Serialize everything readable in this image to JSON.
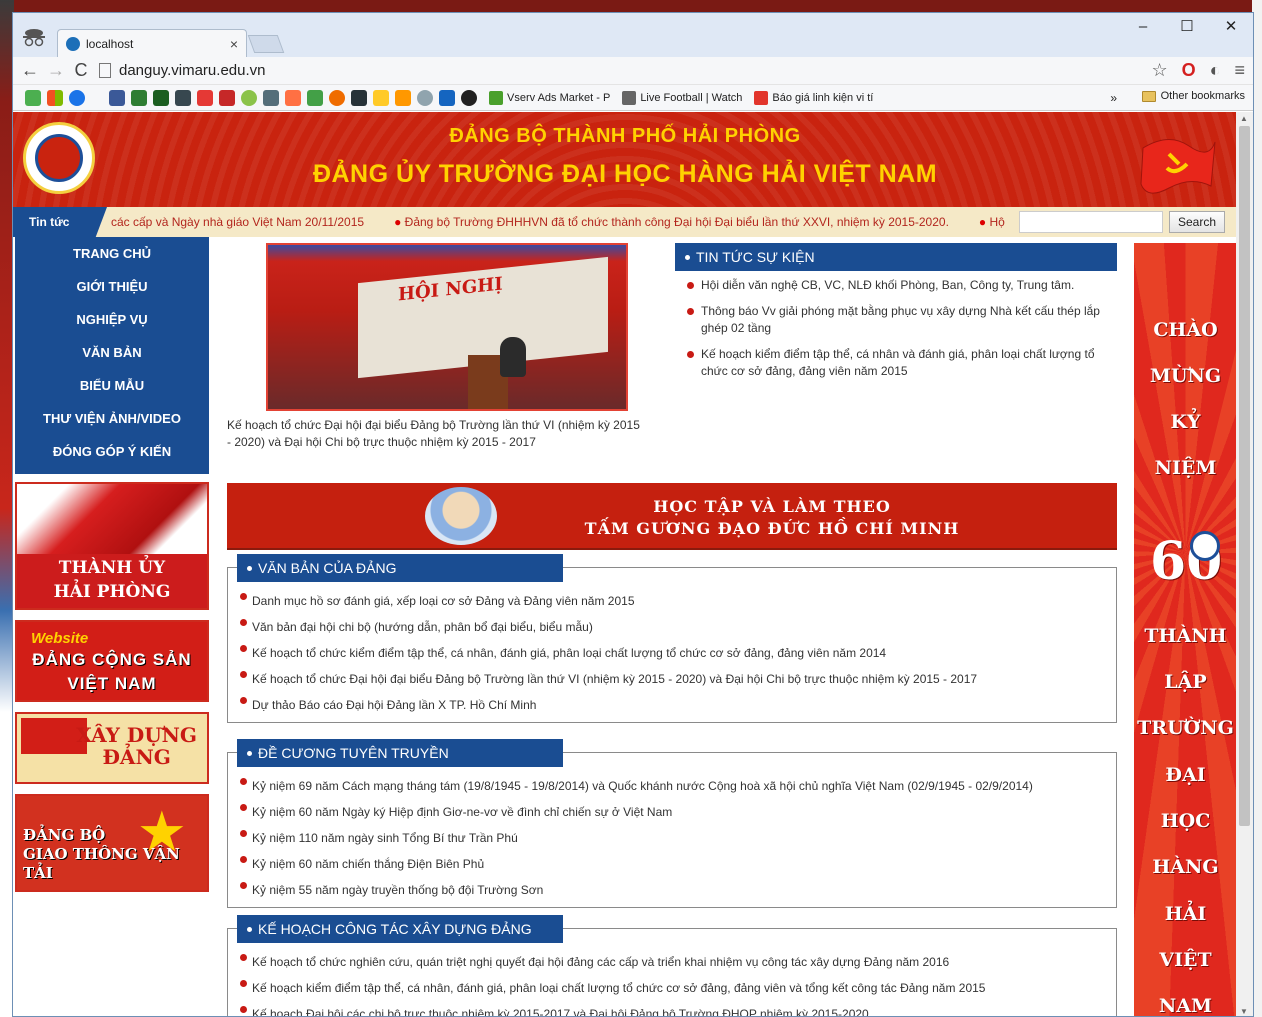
{
  "browser": {
    "tab_title": "localhost",
    "tab_close": "×",
    "window_controls": [
      "–",
      "☐",
      "✕"
    ],
    "url": "danguy.vimaru.edu.vn",
    "bookmarks": [
      {
        "label": "Vserv Ads Market - P",
        "icon_color": "#4aa02c"
      },
      {
        "label": "Live Football | Watch",
        "icon_color": "#666666"
      },
      {
        "label": "Báo giá linh kiện vi tí",
        "icon_color": "#e2352c"
      }
    ],
    "bookmarks_more": "»",
    "other_bookmarks": "Other bookmarks"
  },
  "header": {
    "line1": "ĐẢNG BỘ THÀNH PHỐ HẢI PHÒNG",
    "line2": "ĐẢNG ỦY TRƯỜNG ĐẠI HỌC HÀNG HẢI VIỆT NAM"
  },
  "ticker": {
    "label": "Tin tức",
    "items": [
      "các cấp và Ngày nhà giáo Việt Nam 20/11/2015",
      "Đảng bộ Trường ĐHHHVN đã tổ chức thành công Đại hội Đại biểu lần thứ XXVI, nhiệm kỳ 2015-2020.",
      "Hộ"
    ],
    "search_button": "Search"
  },
  "menu": [
    "TRANG CHỦ",
    "GIỚI THIỆU",
    "NGHIỆP VỤ",
    "VĂN BẢN",
    "BIỂU MẪU",
    "THƯ VIỆN ẢNH/VIDEO",
    "ĐÓNG GÓP Ý KIẾN"
  ],
  "promos": {
    "p1_line1": "THÀNH ỦY",
    "p1_line2": "HẢI PHÒNG",
    "p2_website": "Website",
    "p2_line1": "ĐẢNG CỘNG SẢN",
    "p2_line2": "VIỆT NAM",
    "p3_line1": "XÂY DỰNG",
    "p3_line2": "ĐẢNG",
    "p4_line1": "ĐẢNG BỘ",
    "p4_line2": "GIAO THÔNG VẬN TẢI"
  },
  "featured": {
    "image_text": "HỘI NGHỊ",
    "caption": "Kế hoạch tổ chức Đại hội đại biểu Đảng bộ Trường lần thứ VI (nhiệm kỳ 2015 - 2020) và Đại hội Chi bộ trực thuộc nhiệm kỳ 2015 - 2017"
  },
  "news": {
    "title": "TIN TỨC SỰ KIỆN",
    "items": [
      "Hội diễn văn nghệ CB, VC, NLĐ khối Phòng, Ban, Công ty, Trung tâm.",
      "Thông báo Vv giải phóng mặt bằng phục vụ xây dựng Nhà kết cấu thép lắp ghép 02 tầng",
      "Kế hoạch kiểm điểm tập thể, cá nhân và đánh giá, phân loại chất lượng tổ chức cơ sở đảng, đảng viên năm 2015"
    ]
  },
  "hcm_banner": {
    "line1": "HỌC TẬP VÀ LÀM THEO",
    "line2": "TẤM GƯƠNG ĐẠO ĐỨC HỒ CHÍ MINH"
  },
  "sections": [
    {
      "title": "VĂN BẢN CỦA ĐẢNG",
      "items": [
        "Danh mục hồ sơ đánh giá, xếp loại cơ sở Đảng và Đảng viên năm 2015",
        "Văn bản đại hội chi bộ (hướng dẫn, phân bổ đại biểu, biểu mẫu)",
        "Kế hoạch tổ chức kiểm điểm tập thể, cá nhân, đánh giá, phân loại chất lượng tổ chức cơ sở đảng, đảng viên năm 2014",
        "Kế hoạch tổ chức Đại hội đại biểu Đảng bộ Trường lần thứ VI (nhiệm kỳ 2015 - 2020) và Đại hội Chi bộ trực thuộc nhiệm kỳ 2015 - 2017",
        "Dự thảo Báo cáo Đại hội Đảng lần X TP. Hồ Chí Minh"
      ]
    },
    {
      "title": "ĐỀ CƯƠNG TUYÊN TRUYỀN",
      "items": [
        "Kỷ niệm 69 năm Cách mạng tháng tám (19/8/1945 - 19/8/2014) và Quốc khánh nước Cộng hoà xã hội chủ nghĩa Việt Nam (02/9/1945 - 02/9/2014)",
        "Kỷ niệm 60 năm Ngày ký Hiệp định Giơ-ne-vơ về đình chỉ chiến sự ở Việt Nam",
        "Kỷ niệm 110 năm ngày sinh Tổng Bí thư Trần Phú",
        "Kỷ niệm 60 năm chiến thắng Điện Biên Phủ",
        "Kỷ niệm 55 năm ngày truyền thống bộ đội Trường Sơn"
      ]
    },
    {
      "title": "KẾ HOẠCH CÔNG TÁC XÂY DỰNG ĐẢNG",
      "items": [
        "Kế hoạch tổ chức nghiên cứu, quán triệt nghị quyết đại hội đảng các cấp và triển khai nhiệm vụ công tác xây dựng Đảng năm 2016",
        "Kế hoạch kiểm điểm tập thể, cá nhân, đánh giá, phân loại chất lượng tổ chức cơ sở đảng, đảng viên và tổng kết công tác Đảng năm 2015",
        "Kế hoạch Đại hội các chi bộ trực thuộc nhiệm kỳ 2015-2017 và Đại hội Đảng bộ Trường ĐHQP nhiệm kỳ 2015-2020"
      ]
    }
  ],
  "right_banner": {
    "words": [
      "CHÀO",
      "MỪNG",
      "KỶ",
      "NIỆM",
      "THÀNH",
      "LẬP",
      "TRƯỜNG",
      "ĐẠI",
      "HỌC",
      "HÀNG",
      "HẢI",
      "VIỆT",
      "NAM"
    ],
    "sixty": "60"
  }
}
